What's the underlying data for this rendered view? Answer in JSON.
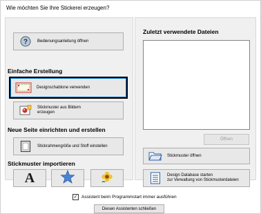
{
  "window": {
    "title": "Wie möchten Sie Ihre Stickerei erzeugen?"
  },
  "left": {
    "help_button": {
      "label": "Bedienungsanleitung öffnen",
      "icon": "help-icon"
    },
    "section_simple": "Einfache Erstellung",
    "template_button": {
      "label": "Designschablone verwenden",
      "icon": "design-template-icon"
    },
    "image_button": {
      "label": "Stickmuster aus Bildern\nerzeugen",
      "icon": "photo-icon"
    },
    "section_newpage": "Neue Seite einrichten und erstellen",
    "hoop_button": {
      "label": "Stickrahmengröße und Stoff einstellen",
      "icon": "hoop-icon"
    },
    "section_import": "Stickmuster importieren",
    "import_buttons": [
      {
        "icon": "font-a-icon"
      },
      {
        "icon": "star-shape-icon"
      },
      {
        "icon": "flower-icon"
      }
    ]
  },
  "right": {
    "recent_label": "Zuletzt verwendete Dateien",
    "open_button": "Öffnen",
    "open_pattern_button": {
      "label": "Stickmuster öffnen",
      "icon": "folder-open-icon"
    },
    "database_button": {
      "label": "Design Database starten\nzur Verwaltung von Stickmusterdateien",
      "icon": "database-list-icon"
    }
  },
  "footer": {
    "checkbox_label": "Assistent beim Programmstart immer ausführen",
    "checkbox_checked": true,
    "close_button": "Diesen Assistenten schließen"
  }
}
